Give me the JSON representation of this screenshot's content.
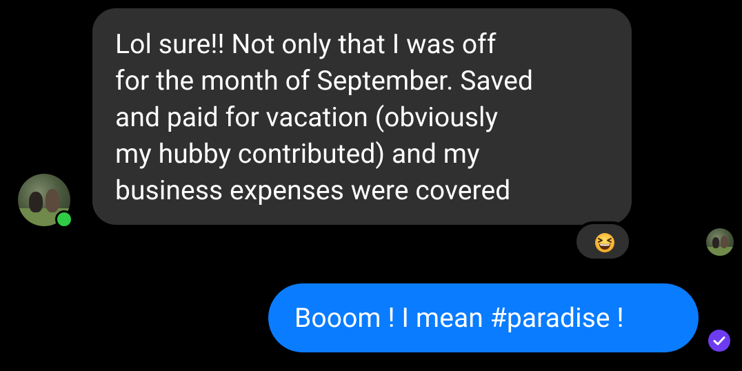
{
  "conversation": {
    "incoming_message": {
      "lines": [
        "Lol sure!!  Not only that I was off",
        "for the month of September. Saved",
        "and paid for vacation (obviously",
        "my hubby contributed) and my",
        "business expenses were covered"
      ],
      "reaction": "laughing-face-emoji",
      "sender_online": true
    },
    "outgoing_message": {
      "text": "Booom ! I mean #paradise !",
      "status": "seen"
    }
  },
  "colors": {
    "background": "#000000",
    "incoming_bubble": "#303030",
    "outgoing_bubble": "#0a7cff",
    "online_dot": "#31cc46",
    "seen_check": "#6d3cf0",
    "text": "#ffffff"
  },
  "icons": {
    "reaction": "laughing-emoji-icon",
    "status": "check-circle-icon",
    "online": "online-dot-icon"
  }
}
